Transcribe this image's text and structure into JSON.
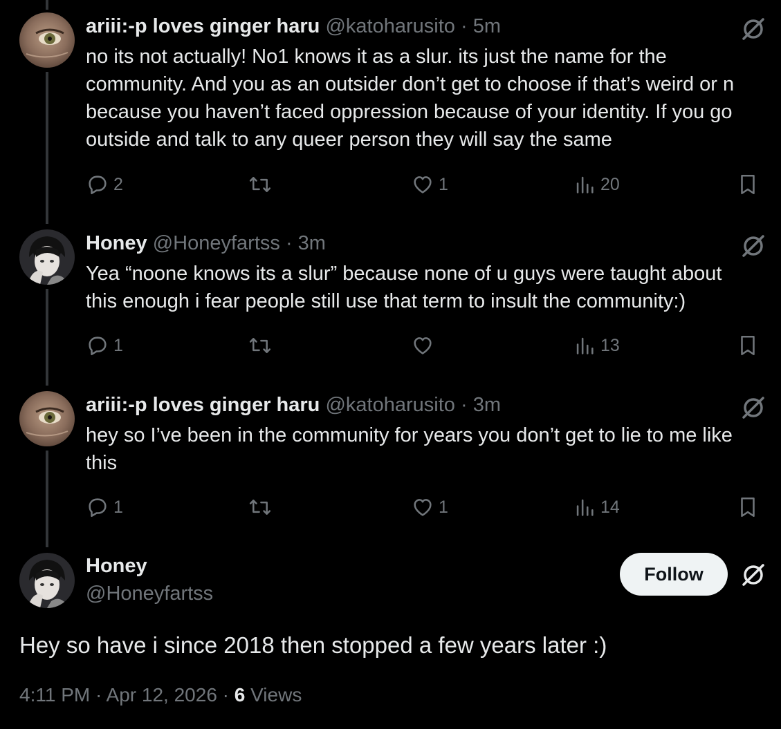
{
  "replies": [
    {
      "name": "ariii:-p loves ginger haru",
      "handle": "@katoharusito",
      "time": "5m",
      "lines": [
        "no its not actually! No1 knows it as a slur. its just the name for the",
        "community. And you as an outsider don’t get to choose if that’s weird or n",
        "because you haven’t faced oppression because of your identity. If you go",
        "outside and talk to any queer person they will say the same"
      ],
      "reply_count": "2",
      "retweet_count": "",
      "like_count": "1",
      "view_count": "20"
    },
    {
      "name": "Honey",
      "handle": "@Honeyfartss",
      "time": "3m",
      "lines": [
        "Yea “noone knows its a slur” because none of u guys were taught about",
        "this enough i fear people still use that term to insult the community:)"
      ],
      "reply_count": "1",
      "retweet_count": "",
      "like_count": "",
      "view_count": "13"
    },
    {
      "name": "ariii:-p loves ginger haru",
      "handle": "@katoharusito",
      "time": "3m",
      "lines": [
        "hey so I’ve been in the community for years you don’t get to lie to me like",
        "this"
      ],
      "reply_count": "1",
      "retweet_count": "",
      "like_count": "1",
      "view_count": "14"
    }
  ],
  "main_tweet": {
    "name": "Honey",
    "handle": "@Honeyfartss",
    "follow_label": "Follow",
    "text": "Hey so have i since 2018 then stopped a few years later :)",
    "time": "4:11 PM",
    "date": "Apr 12, 2026",
    "views_count": "6",
    "views_label": "Views"
  },
  "separator": "·",
  "icons": {
    "reply": "reply-bubble-icon",
    "retweet": "retweet-icon",
    "like": "heart-icon",
    "views": "bar-chart-icon",
    "bookmark": "bookmark-icon",
    "grok": "grok-icon"
  },
  "colors": {
    "background": "#000000",
    "text": "#e7e9ea",
    "muted": "#71767b",
    "thread_line": "#333639",
    "follow_bg": "#eff3f4"
  }
}
